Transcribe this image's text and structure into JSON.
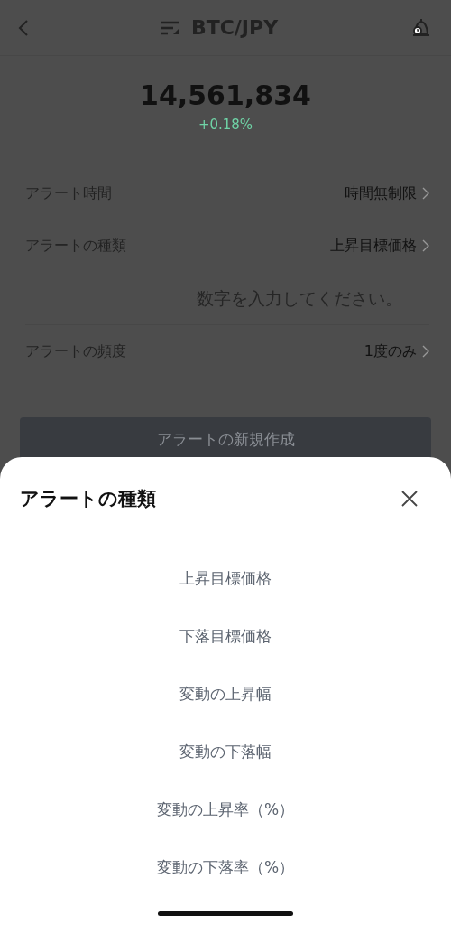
{
  "header": {
    "title": "BTC/JPY"
  },
  "price": {
    "value": "14,561,834",
    "change": "+0.18%"
  },
  "settings": [
    {
      "kind": "select",
      "label": "アラート時間",
      "value": "時間無制限"
    },
    {
      "kind": "select",
      "label": "アラートの種類",
      "value": "上昇目標価格"
    },
    {
      "kind": "input",
      "placeholder": "数字を入力してください。"
    },
    {
      "kind": "select",
      "label": "アラートの頻度",
      "value": "1度のみ"
    }
  ],
  "create_button": {
    "label": "アラートの新規作成"
  },
  "sheet": {
    "title": "アラートの種類",
    "options": [
      "上昇目標価格",
      "下落目標価格",
      "変動の上昇幅",
      "変動の下落幅",
      "変動の上昇率（%）",
      "変動の下落率（%）"
    ]
  }
}
